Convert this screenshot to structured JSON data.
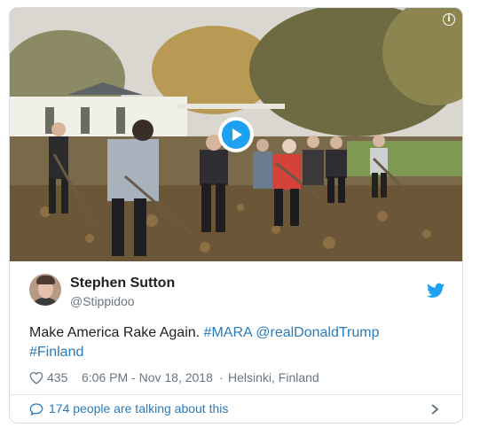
{
  "media": {
    "info_icon": "info-icon",
    "play_icon": "play-icon",
    "accent": "#1da1f2"
  },
  "author": {
    "display_name": "Stephen Sutton",
    "username": "@Stippidoo",
    "avatar_icon": "avatar"
  },
  "brand_icon": "twitter-bird-icon",
  "tweet": {
    "text_plain": "Make America Rake Again.",
    "hashtag_1": "#MARA",
    "mention": "@realDonaldTrump",
    "hashtag_2": "#Finland",
    "link_color": "#2b7bb9"
  },
  "meta": {
    "heart_icon": "heart-icon",
    "likes": "435",
    "timestamp": "6:06 PM - Nov 18, 2018",
    "separator": "·",
    "location": "Helsinki, Finland"
  },
  "footer": {
    "bubble_icon": "speech-bubble-icon",
    "talking_text": "174 people are talking about this",
    "chevron_icon": "chevron-right-icon"
  }
}
